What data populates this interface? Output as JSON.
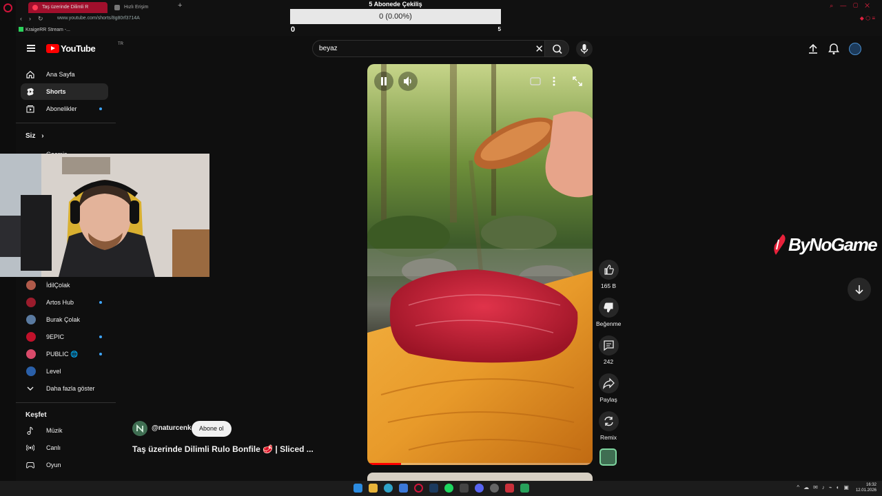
{
  "browser": {
    "tabs": [
      {
        "label": "Taş üzerinde Dilimli R"
      },
      {
        "label": "Hızlı Erişim"
      }
    ],
    "url": "www.youtube.com/shorts/8g80rf3714A",
    "bookmark": "KraigeRR Stream -..."
  },
  "giveaway": {
    "title": "5 Abonede Çekiliş",
    "percent_label": "0 (0.00%)",
    "progress_fraction": 0.0,
    "min": "0",
    "max": "5"
  },
  "youtube": {
    "logo_text": "YouTube",
    "country_code": "TR",
    "search": {
      "query": "beyaz"
    },
    "sidebar": {
      "main": [
        {
          "label": "Ana Sayfa",
          "icon": "home-icon"
        },
        {
          "label": "Shorts",
          "icon": "shorts-icon"
        },
        {
          "label": "Abonelikler",
          "icon": "subscriptions-icon"
        }
      ],
      "you_heading": "Siz",
      "history_partial": "Geçmiş",
      "channels": [
        {
          "label": "İdilÇolak",
          "color": "#b05a4a"
        },
        {
          "label": "Artos Hub",
          "color": "#9b1c2c"
        },
        {
          "label": "Burak Çolak",
          "color": "#5a7aa0"
        },
        {
          "label": "9EPIC",
          "color": "#c0112a"
        },
        {
          "label": "PUBLIC 🌐",
          "color": "#d94a6a"
        },
        {
          "label": "Level",
          "color": "#2a5fa8"
        }
      ],
      "show_more": "Daha fazla göster",
      "explore_heading": "Keşfet",
      "explore": [
        {
          "label": "Müzik",
          "icon": "music-note-icon"
        },
        {
          "label": "Canlı",
          "icon": "live-icon"
        },
        {
          "label": "Oyun",
          "icon": "gamepad-icon"
        }
      ]
    },
    "short": {
      "channel": "@naturcenk",
      "subscribe": "Abone ol",
      "title": "Taş üzerinde Dilimli Rulo Bonfile 🥩 | Sliced ...",
      "progress_fraction": 0.15,
      "actions": {
        "like": "165 B",
        "dislike": "Beğenme",
        "comments": "242",
        "share": "Paylaş",
        "remix": "Remix"
      }
    }
  },
  "overlay": {
    "brand": "ByNoGame"
  },
  "taskbar": {
    "time": "16:32",
    "date": "12.01.2026"
  }
}
